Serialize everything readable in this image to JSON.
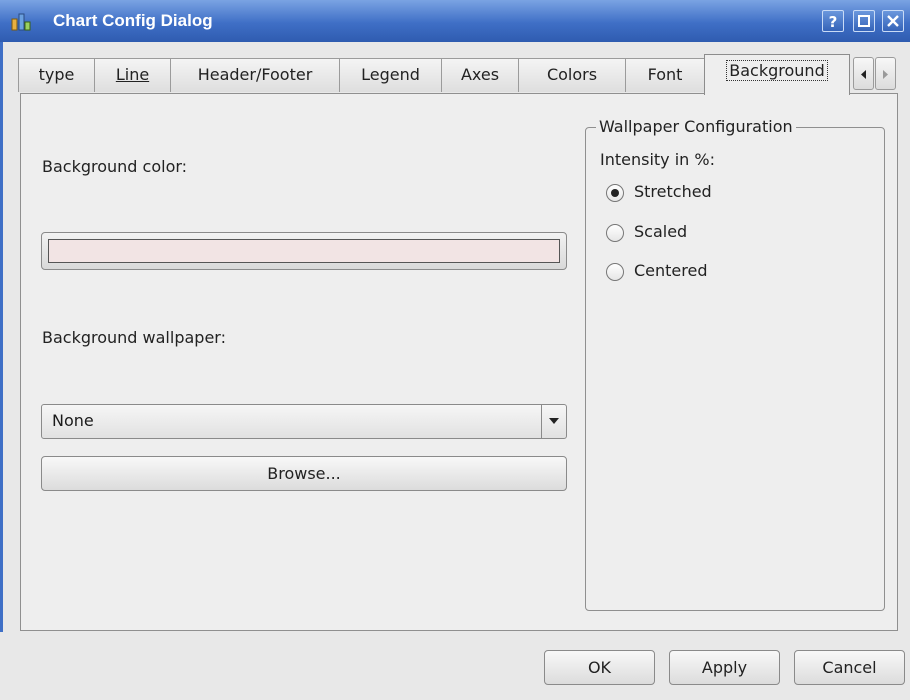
{
  "window": {
    "title": "Chart Config Dialog",
    "buttons": {
      "help": "?",
      "maximize": "maximize",
      "close": "close"
    }
  },
  "tabs": [
    {
      "label": "type",
      "mnemonic": ""
    },
    {
      "label": "Line",
      "mnemonic": "L"
    },
    {
      "label": "Header/Footer",
      "mnemonic": "H"
    },
    {
      "label": "Legend",
      "mnemonic": "e"
    },
    {
      "label": "Axes",
      "mnemonic": "A"
    },
    {
      "label": "Colors",
      "mnemonic": "C"
    },
    {
      "label": "Font",
      "mnemonic": "F"
    },
    {
      "label": "Background",
      "mnemonic": "k",
      "active": true
    }
  ],
  "background": {
    "color_label": "Background color:",
    "color_value": "#f2e4e4",
    "wallpaper_label": "Background wallpaper:",
    "wallpaper_selected": "None",
    "browse_label": "Browse..."
  },
  "wallpaper_config": {
    "title": "Wallpaper Configuration",
    "intensity_label": "Intensity in %:",
    "options": [
      {
        "label": "Stretched",
        "checked": true
      },
      {
        "label": "Scaled",
        "checked": false
      },
      {
        "label": "Centered",
        "checked": false
      }
    ]
  },
  "footer": {
    "ok": "OK",
    "apply": "Apply",
    "cancel": "Cancel"
  }
}
